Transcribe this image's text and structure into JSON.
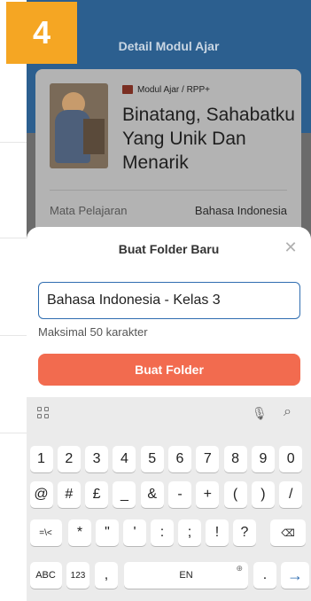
{
  "step_badge": "4",
  "header": {
    "title": "Detail Modul Ajar"
  },
  "module": {
    "badge": "Modul Ajar / RPP+",
    "title": "Binatang, Sahabatku Yang Unik Dan Menarik",
    "meta_label": "Mata Pelajaran",
    "meta_value": "Bahasa Indonesia"
  },
  "sheet": {
    "title": "Buat Folder Baru",
    "close_icon": "close-icon",
    "input_value": "Bahasa Indonesia - Kelas 3",
    "helper": "Maksimal 50 karakter",
    "create_label": "Buat Folder",
    "create_color": "#f26b4f",
    "accent": "#2f6db0"
  },
  "keyboard": {
    "row1": [
      "1",
      "2",
      "3",
      "4",
      "5",
      "6",
      "7",
      "8",
      "9",
      "0"
    ],
    "row2": [
      "@",
      "#",
      "£",
      "_",
      "&",
      "-",
      "+",
      "(",
      ")",
      "/"
    ],
    "row3_fn": "=\\<",
    "row3": [
      "*",
      "\"",
      "'",
      ":",
      ";",
      "!",
      "?"
    ],
    "backspace": "⌫",
    "abc": "ABC",
    "num": "123",
    "comma": ",",
    "space": "EN",
    "period": ".",
    "enter": "→",
    "icons": [
      "grid-icon",
      "mic-icon",
      "search-icon",
      "globe-icon"
    ]
  }
}
